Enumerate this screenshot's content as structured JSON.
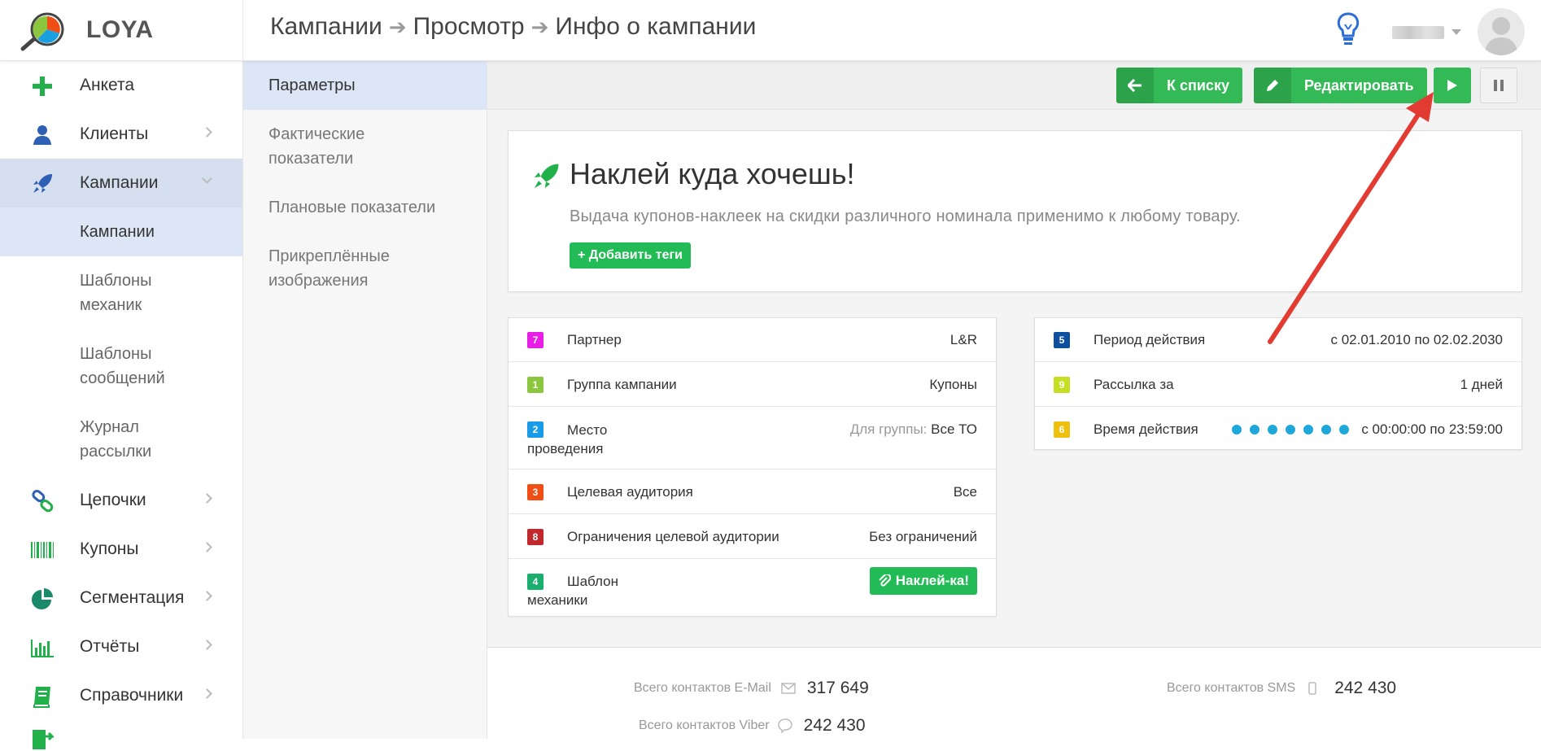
{
  "header": {
    "logo_text": "LOYA",
    "breadcrumb": [
      "Кампании",
      "Просмотр",
      "Инфо о кампании"
    ]
  },
  "sidebar": {
    "items": [
      {
        "label": "Анкета",
        "icon": "plus-icon"
      },
      {
        "label": "Клиенты",
        "icon": "user-icon"
      },
      {
        "label": "Кампании",
        "icon": "rocket-icon"
      },
      {
        "label": "Цепочки",
        "icon": "chain-icon"
      },
      {
        "label": "Купоны",
        "icon": "barcode-icon"
      },
      {
        "label": "Сегментация",
        "icon": "pie-icon"
      },
      {
        "label": "Отчёты",
        "icon": "bar-chart-icon"
      },
      {
        "label": "Справочники",
        "icon": "book-icon"
      }
    ],
    "sub_items": [
      "Кампании",
      "Шаблоны механик",
      "Шаблоны сообщений",
      "Журнал рассылки"
    ]
  },
  "sub_sidebar": {
    "items": [
      "Параметры",
      "Фактические показатели",
      "Плановые показатели",
      "Прикреплённые изображения"
    ]
  },
  "toolbar": {
    "back_label": "К списку",
    "edit_label": "Редактировать"
  },
  "campaign": {
    "title": "Наклей куда хочешь!",
    "description": "Выдача купонов-наклеек на скидки различного номинала применимо к любому товару.",
    "add_tags_label": "+ Добавить теги"
  },
  "left_table": [
    {
      "badge": "7",
      "color": "#e91ee6",
      "key": "Партнер",
      "value": "L&R"
    },
    {
      "badge": "1",
      "color": "#8cc63f",
      "key": "Группа кампании",
      "value": "Купоны"
    },
    {
      "badge": "2",
      "color": "#1a9be8",
      "key": "Место проведения",
      "value_prefix": "Для группы:",
      "value": "Все ТО"
    },
    {
      "badge": "3",
      "color": "#f04e14",
      "key": "Целевая аудитория",
      "value": "Все"
    },
    {
      "badge": "8",
      "color": "#c0282c",
      "key": "Ограничения целевой аудитории",
      "value": "Без ограничений"
    },
    {
      "badge": "4",
      "color": "#1aaf6f",
      "key": "Шаблон механики",
      "value": "Наклей-ка!"
    }
  ],
  "right_table": [
    {
      "badge": "5",
      "color": "#0e4fa0",
      "key": "Период действия",
      "value": "с 02.01.2010 по 02.02.2030"
    },
    {
      "badge": "9",
      "color": "#c5e022",
      "key": "Рассылка за",
      "value": "1 дней"
    },
    {
      "badge": "6",
      "color": "#f0c010",
      "key": "Время действия",
      "value": "с 00:00:00 по 23:59:00"
    }
  ],
  "stats": {
    "email_label": "Всего контактов E-Mail",
    "email_value": "317 649",
    "sms_label": "Всего контактов SMS",
    "sms_value": "242 430",
    "viber_label": "Всего контактов Viber",
    "viber_value": "242 430"
  }
}
